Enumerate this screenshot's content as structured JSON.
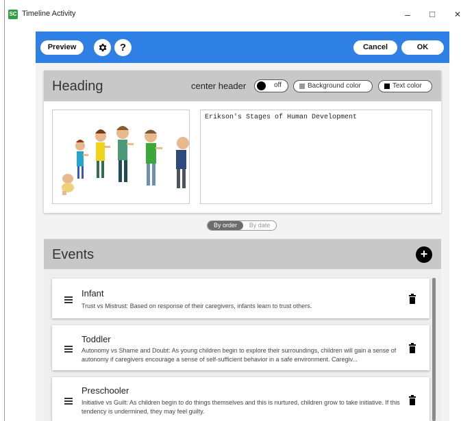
{
  "window": {
    "icon_text": "SC",
    "title": "Timeline Activity",
    "minimize": "–",
    "maximize": "□",
    "close": "✕"
  },
  "toolbar": {
    "preview_label": "Preview",
    "settings_icon": "gear-icon",
    "help_label": "?",
    "cancel_label": "Cancel",
    "ok_label": "OK",
    "accent_color": "#2f80e4"
  },
  "heading": {
    "title": "Heading",
    "center_header_label": "center header",
    "center_header_state": "off",
    "background_color_label": "Background color",
    "text_color_label": "Text color",
    "text_value": "Erikson's Stages of Human Development"
  },
  "sort": {
    "by_order_label": "By order",
    "by_date_label": "By date",
    "selected": "By order"
  },
  "events": {
    "title": "Events",
    "add_label": "+",
    "items": [
      {
        "title": "Infant",
        "description": "Trust vs Mistrust: Based on response of their caregivers, infants learn to trust others."
      },
      {
        "title": "Toddler",
        "description": "Autonomy vs Shame and Doubt: As young children begin to explore their surroundings, children will gain a sense of autonomy if caregivers encourage a sense of self-sufficient behavior in a safe environment. Caregiv..."
      },
      {
        "title": "Preschooler",
        "description": "Initiative vs Guilt: As children begin to do things themselves and this is nurtured, children grow to take initiative. If this tendency is undermined, they may feel guilty."
      }
    ]
  }
}
